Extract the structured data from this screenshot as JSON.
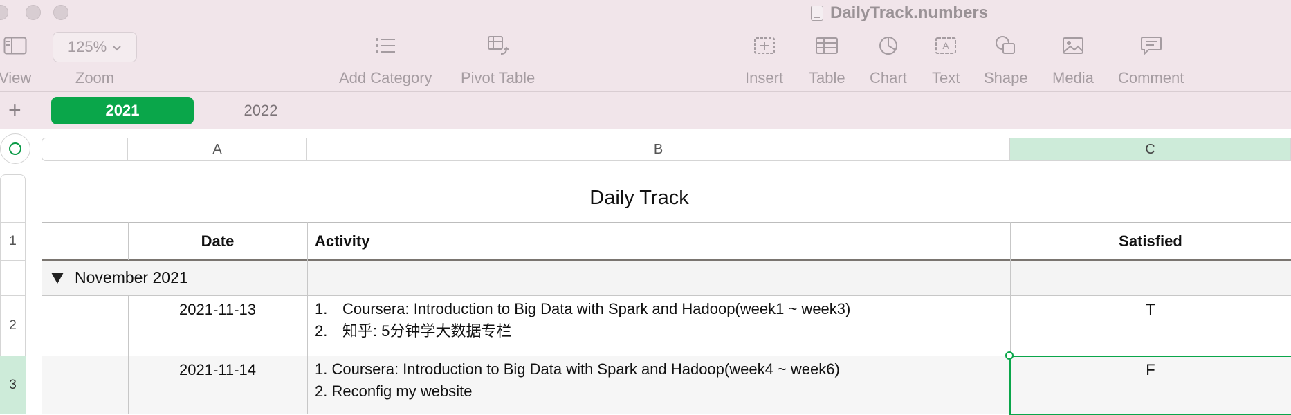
{
  "window": {
    "title": "DailyTrack.numbers"
  },
  "toolbar": {
    "view_label": "View",
    "zoom_value": "125%",
    "zoom_label": "Zoom",
    "add_category_label": "Add Category",
    "pivot_table_label": "Pivot Table",
    "insert_label": "Insert",
    "table_label": "Table",
    "chart_label": "Chart",
    "text_label": "Text",
    "shape_label": "Shape",
    "media_label": "Media",
    "comment_label": "Comment"
  },
  "sheets": {
    "add_symbol": "+",
    "tabs": [
      {
        "label": "2021",
        "active": true
      },
      {
        "label": "2022",
        "active": false
      }
    ]
  },
  "columns": {
    "headers": [
      "A",
      "B",
      "C"
    ],
    "selected": "C"
  },
  "rows": {
    "numbers": [
      "1",
      "2",
      "3"
    ],
    "selected": "3"
  },
  "table": {
    "title": "Daily Track",
    "headers": {
      "date": "Date",
      "activity": "Activity",
      "satisfied": "Satisfied"
    },
    "group_label": "November 2021",
    "rows": [
      {
        "date": "2021-11-13",
        "activity": [
          {
            "num": "1.",
            "text": "Coursera: Introduction to Big Data with Spark and Hadoop(week1 ~ week3)"
          },
          {
            "num": "2.",
            "text": "知乎: 5分钟学大数据专栏"
          }
        ],
        "satisfied": "T"
      },
      {
        "date": "2021-11-14",
        "activity": [
          "1. Coursera: Introduction to Big Data with Spark and Hadoop(week4 ~ week6)",
          "2. Reconfig my website"
        ],
        "satisfied": "F"
      }
    ]
  },
  "colors": {
    "chrome_bg": "#f1e5ea",
    "accent_green": "#0aa64a",
    "selection_fill": "#cdebd9"
  }
}
